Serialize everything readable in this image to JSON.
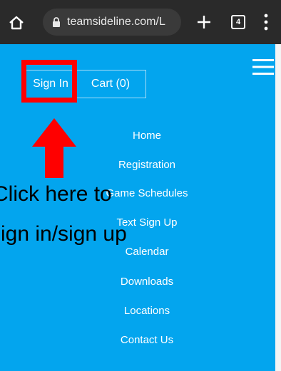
{
  "browser": {
    "url": "teamsideline.com/L",
    "tab_count": "4",
    "icons": [
      "home-icon",
      "lock-icon",
      "new-tab-icon",
      "tab-switcher-icon",
      "more-icon"
    ]
  },
  "site": {
    "background_color": "#03a5ee",
    "sign_in_label": "Sign In",
    "cart_label": "Cart (0)",
    "menu_icon": "hamburger-icon",
    "nav_items": [
      {
        "label": "Home"
      },
      {
        "label": "Registration"
      },
      {
        "label": "Game Schedules"
      },
      {
        "label": "Text Sign Up"
      },
      {
        "label": "Calendar"
      },
      {
        "label": "Downloads"
      },
      {
        "label": "Locations"
      },
      {
        "label": "Contact Us"
      }
    ]
  },
  "annotation": {
    "highlight_color": "#ff0000",
    "arrow_icon": "up-arrow-icon",
    "line1": "Click here to",
    "line2": "sign in/sign up"
  }
}
